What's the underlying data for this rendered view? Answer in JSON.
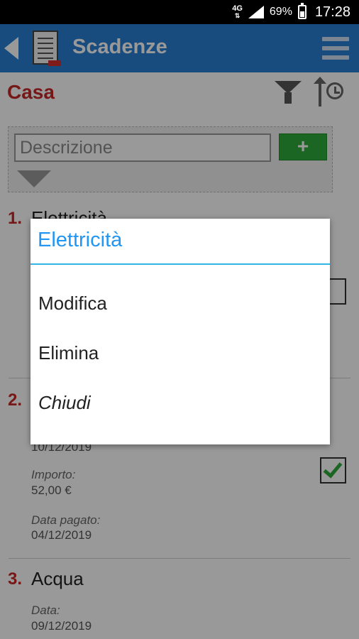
{
  "status_bar": {
    "network": "4G",
    "battery": "69%",
    "time": "17:28"
  },
  "app_bar": {
    "title": "Scadenze"
  },
  "category": {
    "title": "Casa"
  },
  "search": {
    "placeholder": "Descrizione",
    "add_label": "+"
  },
  "items": [
    {
      "number": "1.",
      "name": "Elettricità",
      "paid": false
    },
    {
      "number": "2.",
      "date": "10/12/2019",
      "amount_label": "Importo:",
      "amount": "52,00 €",
      "paid_date_label": "Data pagato:",
      "paid_date": "04/12/2019",
      "paid": true
    },
    {
      "number": "3.",
      "name": "Acqua",
      "date_label": "Data:",
      "date": "09/12/2019"
    }
  ],
  "dialog": {
    "title": "Elettricità",
    "options": [
      "Modifica",
      "Elimina",
      "Chiudi"
    ]
  }
}
